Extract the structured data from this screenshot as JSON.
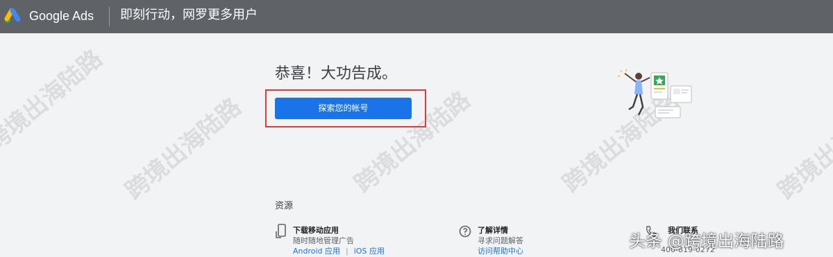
{
  "header": {
    "brand": "Google Ads",
    "tagline": "即刻行动，网罗更多用户",
    "logo_icon": "google-ads-logo-icon",
    "colors": {
      "bar": "#5f6368",
      "logo_blue": "#4285f4",
      "logo_yellow": "#fbbc04",
      "logo_green": "#34a853"
    }
  },
  "main": {
    "congrats_text": "恭喜！大功告成。",
    "explore_button": "探索您的帐号",
    "highlight_color": "#e53935",
    "button_color": "#1a73e8"
  },
  "resources": {
    "title": "资源",
    "items": [
      {
        "icon": "phone-icon",
        "title": "下载移动应用",
        "desc": "随时随地管理广告",
        "links": [
          "Android 应用",
          "iOS 应用"
        ]
      },
      {
        "icon": "question-icon",
        "title": "了解详情",
        "desc": "寻求问题解答",
        "links": [
          "访问帮助中心"
        ]
      },
      {
        "icon": "phone-contact-icon",
        "title": "我们联系",
        "desc": "400-819-0272",
        "links": []
      }
    ]
  },
  "watermark": {
    "text": "跨境出海陆路"
  },
  "caption": {
    "text": "头条 @跨境出海陆路"
  }
}
